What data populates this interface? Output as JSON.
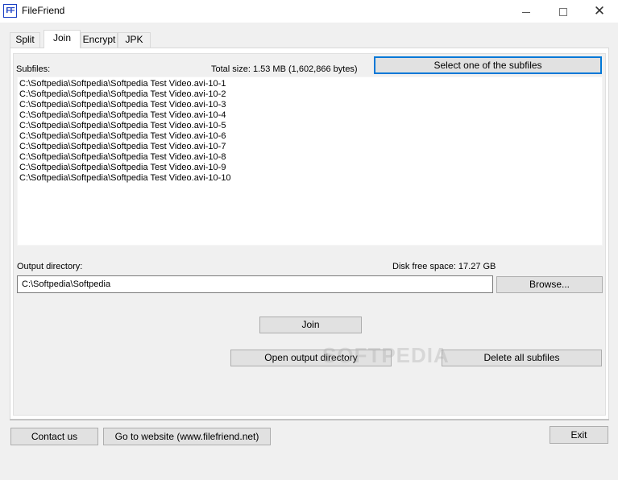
{
  "window": {
    "app_icon_text": "FF",
    "title": "FileFriend",
    "minimize": "",
    "maximize": "",
    "close": "✕"
  },
  "tabs": [
    {
      "label": "Split"
    },
    {
      "label": "Join",
      "selected": true
    },
    {
      "label": "Encrypt"
    },
    {
      "label": "JPK"
    }
  ],
  "join": {
    "subfiles_label": "Subfiles:",
    "total_size": "Total size: 1.53 MB (1,602,866 bytes)",
    "select_button": "Select one of the subfiles",
    "subfiles": [
      "C:\\Softpedia\\Softpedia\\Softpedia Test Video.avi-10-1",
      "C:\\Softpedia\\Softpedia\\Softpedia Test Video.avi-10-2",
      "C:\\Softpedia\\Softpedia\\Softpedia Test Video.avi-10-3",
      "C:\\Softpedia\\Softpedia\\Softpedia Test Video.avi-10-4",
      "C:\\Softpedia\\Softpedia\\Softpedia Test Video.avi-10-5",
      "C:\\Softpedia\\Softpedia\\Softpedia Test Video.avi-10-6",
      "C:\\Softpedia\\Softpedia\\Softpedia Test Video.avi-10-7",
      "C:\\Softpedia\\Softpedia\\Softpedia Test Video.avi-10-8",
      "C:\\Softpedia\\Softpedia\\Softpedia Test Video.avi-10-9",
      "C:\\Softpedia\\Softpedia\\Softpedia Test Video.avi-10-10"
    ],
    "output_label": "Output directory:",
    "disk_free": "Disk free space: 17.27 GB",
    "output_value": "C:\\Softpedia\\Softpedia",
    "browse_button": "Browse...",
    "join_button": "Join",
    "open_output_button": "Open output directory",
    "delete_all_button": "Delete all subfiles"
  },
  "footer": {
    "contact_button": "Contact us",
    "website_button": "Go to website (www.filefriend.net)",
    "exit_button": "Exit"
  },
  "watermark": "SOFTPEDIA",
  "colors": {
    "focus_border": "#0078d7",
    "app_icon": "#1a3fc4"
  },
  "icons": {
    "app": "filefriend-app-icon",
    "minimize": "minimize-icon",
    "maximize": "maximize-icon",
    "close": "close-icon"
  }
}
